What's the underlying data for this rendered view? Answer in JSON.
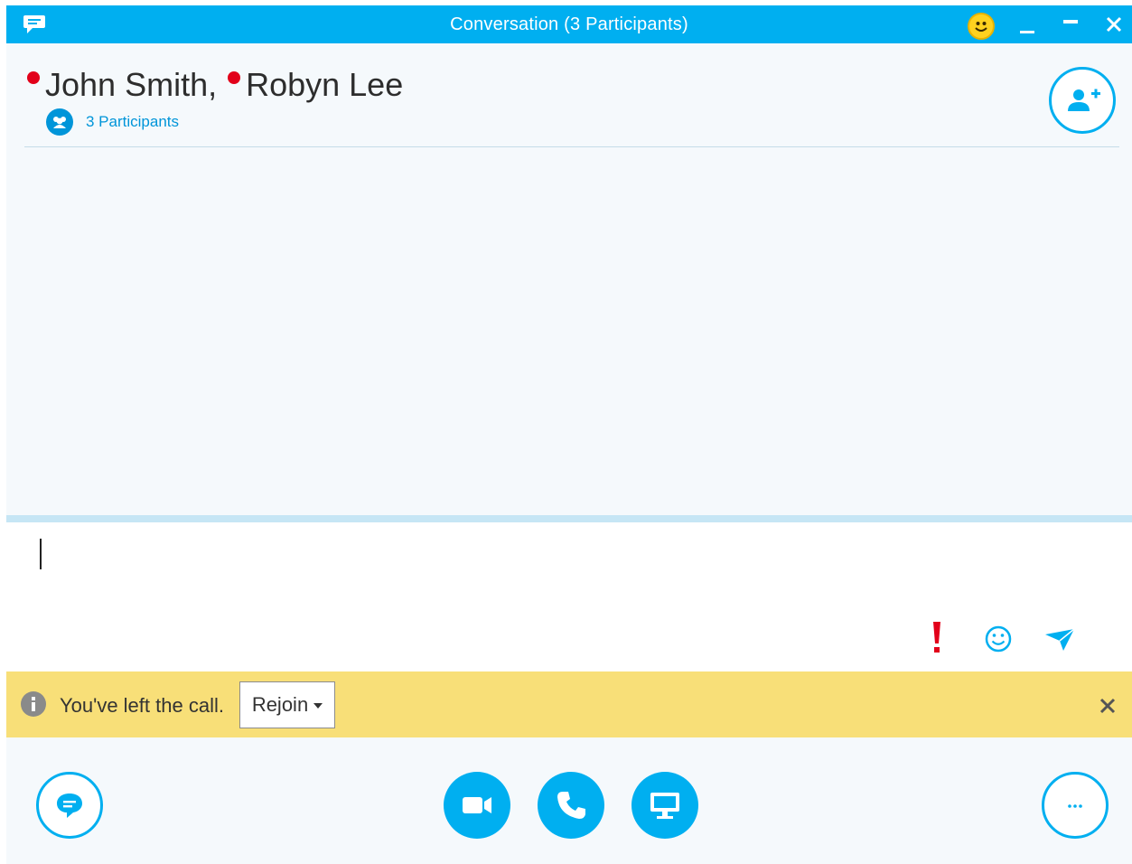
{
  "window": {
    "title": "Conversation (3 Participants)",
    "controls": [
      "minimize",
      "restore",
      "close"
    ]
  },
  "header": {
    "participants": [
      {
        "name": "John Smith,",
        "presence": "busy"
      },
      {
        "name": "Robyn Lee",
        "presence": "busy"
      }
    ],
    "participant_count_label": "3 Participants",
    "presence_color": "#e2001a"
  },
  "compose": {
    "value": "",
    "placeholder": ""
  },
  "notification": {
    "message": "You've left the call.",
    "rejoin_label": "Rejoin"
  },
  "colors": {
    "accent": "#00aff0",
    "notification_bg": "#f8df78"
  },
  "icons": {
    "app": "chat-bubble-icon",
    "emoticon_title": "smiley-icon",
    "add_participant": "add-person-icon",
    "urgent": "exclamation-icon",
    "emoticon": "smiley-outline-icon",
    "send": "send-arrow-icon",
    "info": "info-icon",
    "im": "chat-bubble-icon",
    "video": "video-camera-icon",
    "audio": "phone-icon",
    "present": "monitor-icon",
    "more": "more-options-icon"
  }
}
